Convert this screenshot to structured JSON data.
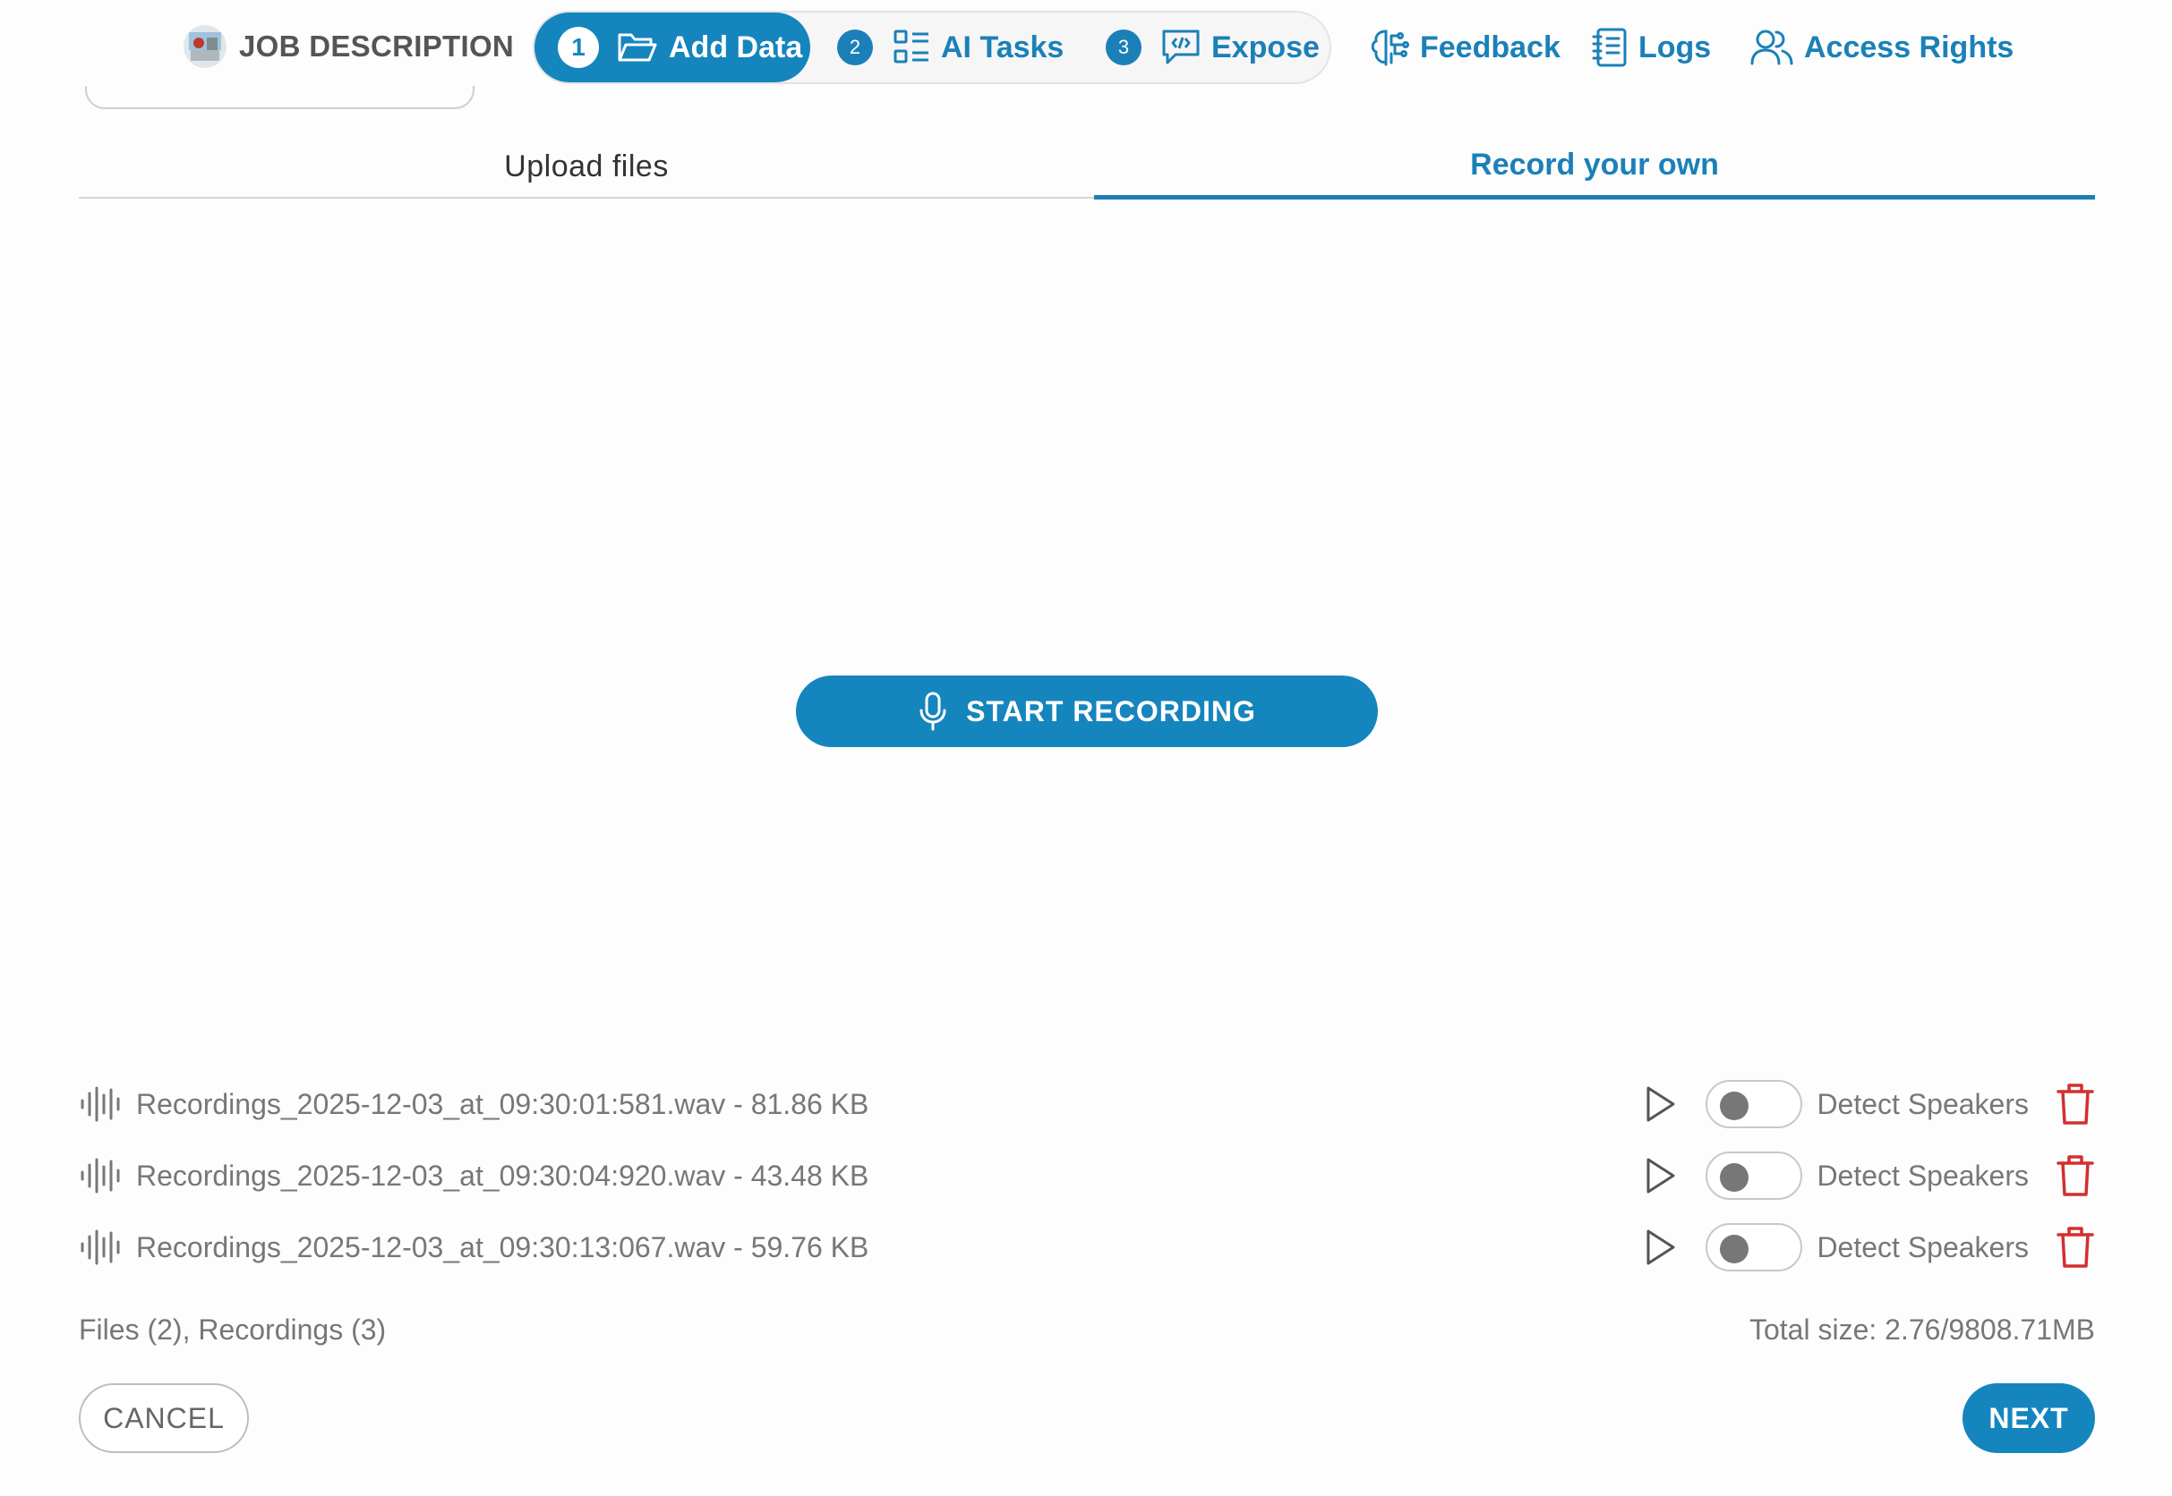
{
  "header": {
    "job_label": "JOB DESCRIPTION",
    "steps": [
      {
        "number": "1",
        "label": "Add Data",
        "icon": "folder-open-icon",
        "active": true
      },
      {
        "number": "2",
        "label": "AI Tasks",
        "icon": "list-tasks-icon",
        "active": false
      },
      {
        "number": "3",
        "label": "Expose",
        "icon": "chat-code-icon",
        "active": false
      }
    ],
    "links": [
      {
        "label": "Feedback",
        "icon": "brain-icon"
      },
      {
        "label": "Logs",
        "icon": "notebook-icon"
      },
      {
        "label": "Access Rights",
        "icon": "users-icon"
      }
    ]
  },
  "tabs": {
    "upload": "Upload files",
    "record": "Record your own",
    "active": "record"
  },
  "recorder": {
    "start_label": "START RECORDING",
    "icon": "microphone-icon"
  },
  "recordings": [
    {
      "name": "Recordings_2025-12-03_at_09:30:01:581.wav - 81.86 KB",
      "detect_label": "Detect Speakers",
      "detect_on": false
    },
    {
      "name": "Recordings_2025-12-03_at_09:30:04:920.wav - 43.48 KB",
      "detect_label": "Detect Speakers",
      "detect_on": false
    },
    {
      "name": "Recordings_2025-12-03_at_09:30:13:067.wav - 59.76 KB",
      "detect_label": "Detect Speakers",
      "detect_on": false
    }
  ],
  "footer": {
    "counts": "Files (2), Recordings (3)",
    "total_size": "Total size: 2.76/9808.71MB",
    "cancel_label": "CANCEL",
    "next_label": "NEXT"
  },
  "colors": {
    "accent": "#1585bd",
    "link": "#1b80b8",
    "delete": "#d32f2f",
    "muted_text": "#777777"
  }
}
